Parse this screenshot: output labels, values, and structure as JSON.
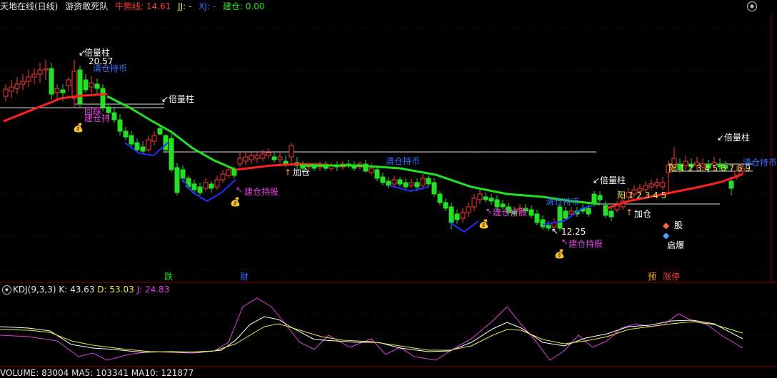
{
  "header": {
    "title": "天地在线(日线)",
    "indicator_name": "游资敢死队",
    "niu_label": "牛熊线: 14.61",
    "jj_label": "JJ: -",
    "xj_label": "XJ: -",
    "jiancang_label": "建仓: 0.00"
  },
  "kdj": {
    "name": "KDJ(9,3,3)",
    "k": "K: 43.63",
    "d": "D: 53.03",
    "j": "J: 24.83"
  },
  "volume": {
    "label": "VOLUME: 83004  MA5: 103341  MA10: 121877"
  },
  "markers": {
    "bei_li_zhu": "倍量柱",
    "qingcang": "清仓持币",
    "jiancang": "建仓持股",
    "jiacang": "加仓",
    "huixi": "回踩",
    "jiancang_short": "建仓持",
    "price_high": "20.57",
    "price_low": "12.25",
    "yang_seq1": "阳 1 2 3 4 5 6 7 8 9",
    "yang_seq2": "阳 1 2 3 4 5",
    "die": "跌",
    "cai": "财",
    "yu": "预",
    "zhangting": "涨停",
    "qidong": "启爆",
    "gu": "股"
  },
  "colors": {
    "up": "#ff3b3b",
    "down": "#26e026",
    "bull_line": "#ff2020",
    "bear_line": "#22e022",
    "blue_line": "#2030ff",
    "k_line": "#ffffff",
    "d_line": "#e8e84a",
    "j_line": "#e040e0"
  }
}
